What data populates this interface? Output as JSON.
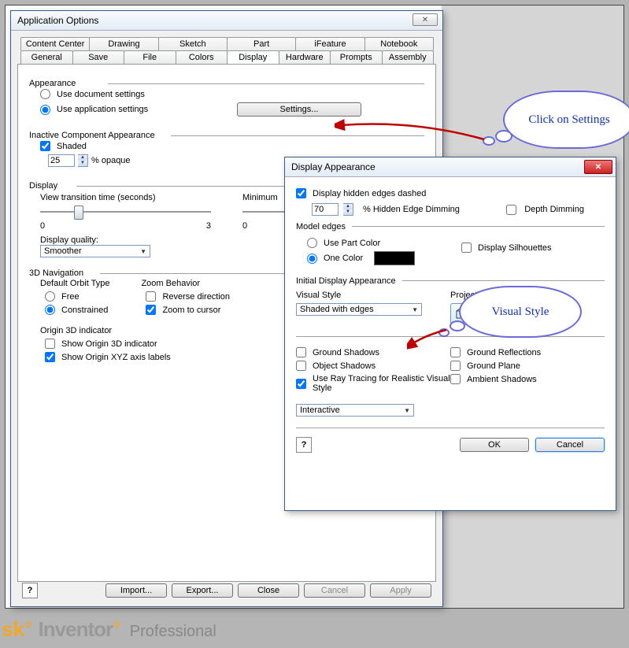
{
  "app_opts": {
    "title": "Application Options",
    "tabs_row1": [
      "Content Center",
      "Drawing",
      "Sketch",
      "Part",
      "iFeature",
      "Notebook"
    ],
    "tabs_row2": [
      "General",
      "Save",
      "File",
      "Colors",
      "Display",
      "Hardware",
      "Prompts",
      "Assembly"
    ],
    "active_tab": "Display",
    "appearance": {
      "section": "Appearance",
      "doc_settings": "Use document settings",
      "app_settings": "Use application settings",
      "settings_btn": "Settings..."
    },
    "inactive": {
      "section": "Inactive Component Appearance",
      "shaded": "Shaded",
      "opaque_value": "25",
      "opaque_label": "% opaque"
    },
    "display": {
      "section": "Display",
      "view_trans": "View transition time (seconds)",
      "min_label": "Minimum",
      "scale_left": "0",
      "scale_right": "3",
      "scale2_left": "0",
      "quality_label": "Display quality:",
      "quality_value": "Smoother"
    },
    "nav": {
      "section": "3D Navigation",
      "orbit_label": "Default Orbit Type",
      "free": "Free",
      "constrained": "Constrained",
      "zoom_label": "Zoom Behavior",
      "reverse": "Reverse direction",
      "cursor": "Zoom to cursor",
      "origin_label": "Origin 3D indicator",
      "show_origin": "Show Origin 3D indicator",
      "show_xyz": "Show Origin XYZ axis labels"
    },
    "buttons": {
      "import": "Import...",
      "export": "Export...",
      "close": "Close",
      "cancel": "Cancel",
      "apply": "Apply"
    }
  },
  "disp_app": {
    "title": "Display Appearance",
    "hidden_dashed": "Display hidden edges dashed",
    "hidden_value": "70",
    "hidden_label": "% Hidden Edge Dimming",
    "depth": "Depth Dimming",
    "model_edges": "Model edges",
    "use_part": "Use Part Color",
    "one_color": "One Color",
    "silhouettes": "Display Silhouettes",
    "initial": "Initial Display Appearance",
    "visual_style": "Visual Style",
    "visual_value": "Shaded with edges",
    "projection": "Projection",
    "ground_shadows": "Ground Shadows",
    "object_shadows": "Object Shadows",
    "raytrace": "Use Ray Tracing for Realistic Visual Style",
    "ground_refl": "Ground Reflections",
    "ground_plane": "Ground Plane",
    "ambient": "Ambient Shadows",
    "interactive": "Interactive",
    "ok": "OK",
    "cancel": "Cancel"
  },
  "callouts": {
    "settings": "Click on Settings",
    "visual": "Visual Style"
  },
  "brand": {
    "sk": "sk",
    "inv": "Inventor",
    "pro": "Professional"
  }
}
